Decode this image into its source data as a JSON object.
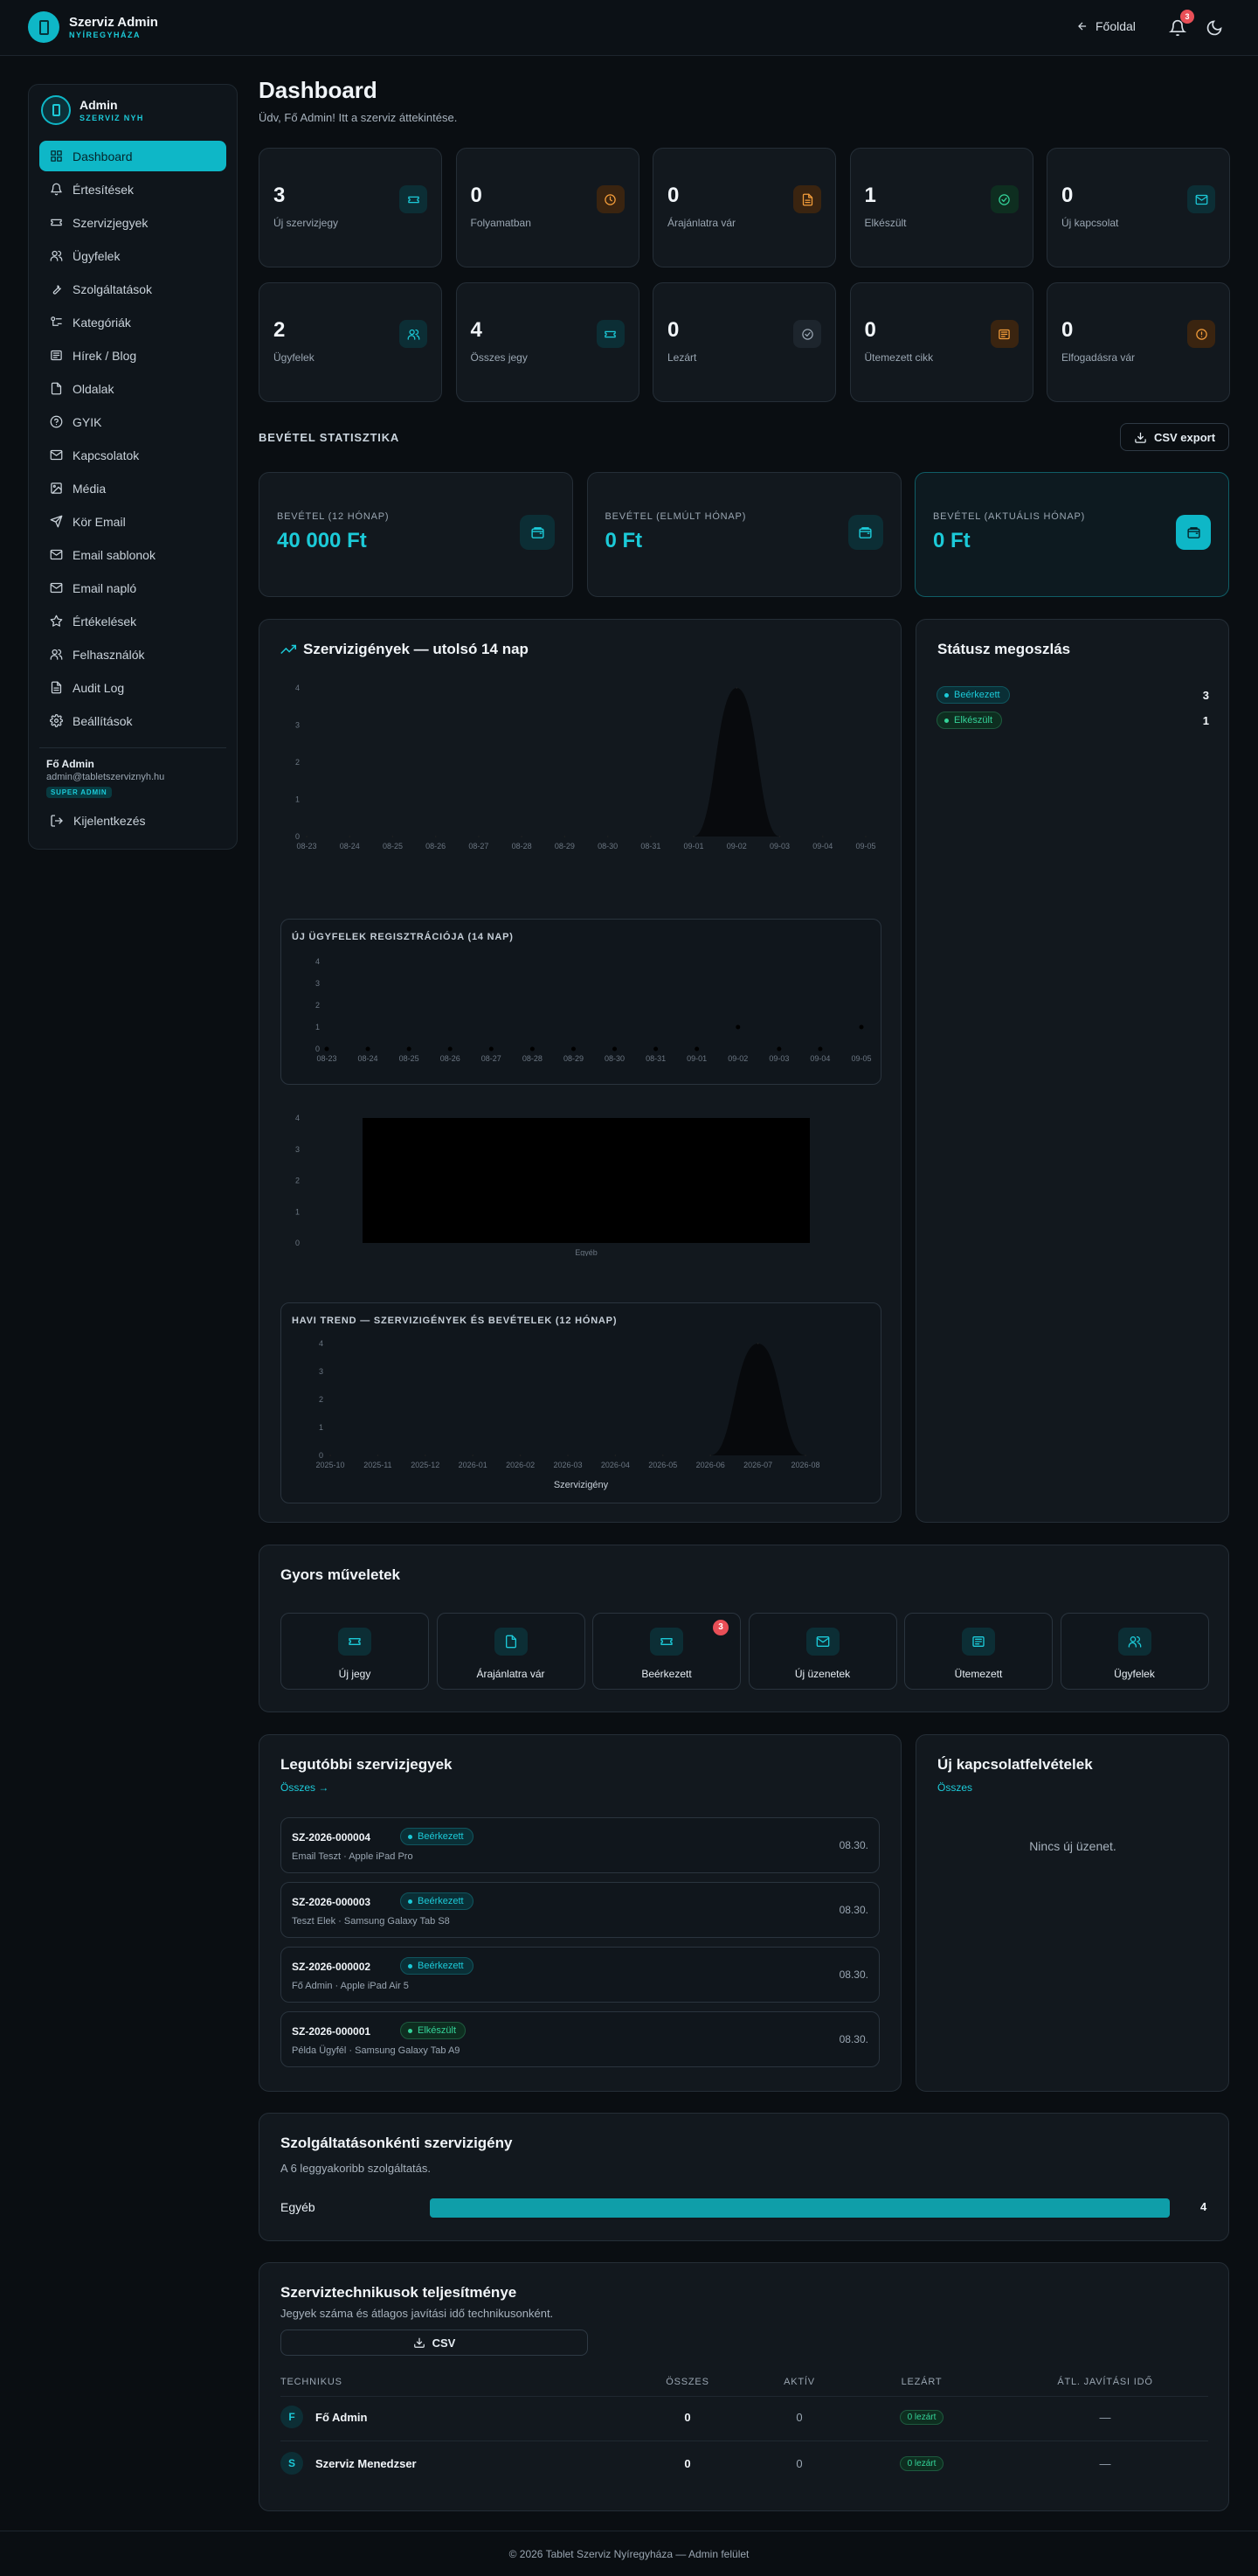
{
  "topbar": {
    "brand_title": "Szerviz Admin",
    "brand_sub": "NYÍREGYHÁZA",
    "back_label": "Főoldal",
    "notif_count": "3"
  },
  "sidebar": {
    "title": "Admin",
    "subtitle": "SZERVIZ NYH",
    "items": [
      {
        "label": "Dashboard",
        "icon": "dashboard-icon"
      },
      {
        "label": "Értesítések",
        "icon": "bell-icon"
      },
      {
        "label": "Szervizjegyek",
        "icon": "ticket-icon"
      },
      {
        "label": "Ügyfelek",
        "icon": "users-icon"
      },
      {
        "label": "Szolgáltatások",
        "icon": "wrench-icon"
      },
      {
        "label": "Kategóriák",
        "icon": "category-icon"
      },
      {
        "label": "Hírek / Blog",
        "icon": "newspaper-icon"
      },
      {
        "label": "Oldalak",
        "icon": "page-icon"
      },
      {
        "label": "GYIK",
        "icon": "help-icon"
      },
      {
        "label": "Kapcsolatok",
        "icon": "mail-icon"
      },
      {
        "label": "Média",
        "icon": "image-icon"
      },
      {
        "label": "Kör Email",
        "icon": "send-icon"
      },
      {
        "label": "Email sablonok",
        "icon": "mail-template-icon"
      },
      {
        "label": "Email napló",
        "icon": "mail-log-icon"
      },
      {
        "label": "Értékelések",
        "icon": "star-icon"
      },
      {
        "label": "Felhasználók",
        "icon": "users-icon"
      },
      {
        "label": "Audit Log",
        "icon": "file-icon"
      },
      {
        "label": "Beállítások",
        "icon": "gear-icon"
      }
    ],
    "user_name": "Fő Admin",
    "user_email": "admin@tabletszerviznyh.hu",
    "user_role": "SUPER ADMIN",
    "logout_label": "Kijelentkezés"
  },
  "page": {
    "title": "Dashboard",
    "subtitle": "Üdv, Fő Admin! Itt a szerviz áttekintése."
  },
  "stats": [
    {
      "value": "3",
      "label": "Új szervizjegy"
    },
    {
      "value": "0",
      "label": "Folyamatban"
    },
    {
      "value": "0",
      "label": "Árajánlatra vár"
    },
    {
      "value": "1",
      "label": "Elkészült"
    },
    {
      "value": "0",
      "label": "Új kapcsolat"
    },
    {
      "value": "2",
      "label": "Ügyfelek"
    },
    {
      "value": "4",
      "label": "Összes jegy"
    },
    {
      "value": "0",
      "label": "Lezárt"
    },
    {
      "value": "0",
      "label": "Ütemezett cikk"
    },
    {
      "value": "0",
      "label": "Elfogadásra vár"
    }
  ],
  "revenue": {
    "section_title": "BEVÉTEL STATISZTIKA",
    "csv_label": "CSV export",
    "cards": [
      {
        "label": "BEVÉTEL (12 HÓNAP)",
        "value": "40 000 Ft"
      },
      {
        "label": "BEVÉTEL (ELMÚLT HÓNAP)",
        "value": "0 Ft"
      },
      {
        "label": "BEVÉTEL (AKTUÁLIS HÓNAP)",
        "value": "0 Ft"
      }
    ]
  },
  "tickets_chart": {
    "title": "Szervizigények — utolsó 14 nap"
  },
  "customers_chart": {
    "title": "ÚJ ÜGYFELEK REGISZTRÁCIÓJA (14 NAP)"
  },
  "monthly_chart": {
    "title": "HAVI TREND — SZERVIZIGÉNYEK ÉS BEVÉTELEK (12 HÓNAP)",
    "legend": "Szervizigény"
  },
  "chart_data": [
    {
      "type": "area",
      "title": "Szervizigények — utolsó 14 nap",
      "x": [
        "08-23",
        "08-24",
        "08-25",
        "08-26",
        "08-27",
        "08-28",
        "08-29",
        "08-30",
        "08-31",
        "09-01",
        "09-02",
        "09-03",
        "09-04",
        "09-05"
      ],
      "values": [
        0,
        0,
        0,
        0,
        0,
        0,
        0,
        0,
        0,
        0,
        4,
        0,
        0,
        0
      ],
      "ylim": [
        0,
        4
      ],
      "yticks": [
        0,
        1,
        2,
        3,
        4
      ]
    },
    {
      "type": "line",
      "title": "ÚJ ÜGYFELEK REGISZTRÁCIÓJA (14 NAP)",
      "x": [
        "08-23",
        "08-24",
        "08-25",
        "08-26",
        "08-27",
        "08-28",
        "08-29",
        "08-30",
        "08-31",
        "09-01",
        "09-02",
        "09-03",
        "09-04",
        "09-05"
      ],
      "values": [
        0,
        0,
        0,
        0,
        0,
        0,
        0,
        0,
        0,
        0,
        1,
        0,
        0,
        1
      ],
      "ylim": [
        0,
        4
      ],
      "yticks": [
        0,
        1,
        2,
        3,
        4
      ]
    },
    {
      "type": "bar",
      "title": "",
      "categories": [
        "Egyéb"
      ],
      "values": [
        4
      ],
      "ylim": [
        0,
        4
      ],
      "yticks": [
        0,
        1,
        2,
        3,
        4
      ]
    },
    {
      "type": "area",
      "title": "HAVI TREND — SZERVIZIGÉNYEK ÉS BEVÉTELEK (12 HÓNAP)",
      "x": [
        "2025-10",
        "2025-11",
        "2025-12",
        "2026-01",
        "2026-02",
        "2026-03",
        "2026-04",
        "2026-05",
        "2026-06",
        "2026-07",
        "2026-08"
      ],
      "series": [
        {
          "name": "Szervizigény",
          "values": [
            0,
            0,
            0,
            0,
            0,
            0,
            0,
            0,
            0,
            4,
            0
          ]
        }
      ],
      "ylim": [
        0,
        4
      ],
      "yticks": [
        0,
        1,
        2,
        3,
        4
      ]
    }
  ],
  "status_split": {
    "title": "Státusz megoszlás",
    "rows": [
      {
        "label": "Beérkezett",
        "count": "3"
      },
      {
        "label": "Elkészült",
        "count": "1"
      }
    ]
  },
  "quick": {
    "title": "Gyors műveletek",
    "items": [
      {
        "label": "Új jegy"
      },
      {
        "label": "Árajánlatra vár"
      },
      {
        "label": "Beérkezett",
        "badge": "3"
      },
      {
        "label": "Új üzenetek"
      },
      {
        "label": "Ütemezett"
      },
      {
        "label": "Ügyfelek"
      }
    ]
  },
  "recent": {
    "title": "Legutóbbi szervizjegyek",
    "all_label": "Összes →",
    "tickets": [
      {
        "id": "SZ-2026-000004",
        "status": "Beérkezett",
        "sub": "Email Teszt · Apple iPad Pro",
        "date": "08.30."
      },
      {
        "id": "SZ-2026-000003",
        "status": "Beérkezett",
        "sub": "Teszt Elek · Samsung Galaxy Tab S8",
        "date": "08.30."
      },
      {
        "id": "SZ-2026-000002",
        "status": "Beérkezett",
        "sub": "Fő Admin · Apple iPad Air 5",
        "date": "08.30."
      },
      {
        "id": "SZ-2026-000001",
        "status": "Elkészült",
        "sub": "Példa Ügyfél · Samsung Galaxy Tab A9",
        "date": "08.30."
      }
    ]
  },
  "contacts": {
    "title": "Új kapcsolatfelvételek",
    "all_label": "Összes",
    "empty": "Nincs új üzenet."
  },
  "services": {
    "title": "Szolgáltatásonkénti szervizigény",
    "subtitle": "A 6 leggyakoribb szolgáltatás.",
    "rows": [
      {
        "name": "Egyéb",
        "value": "4",
        "fraction": 1
      }
    ]
  },
  "techs": {
    "title": "Szerviztechnikusok teljesítménye",
    "subtitle": "Jegyek száma és átlagos javítási idő technikusonként.",
    "csv_label": "CSV",
    "headers": [
      "TECHNIKUS",
      "ÖSSZES",
      "AKTÍV",
      "LEZÁRT",
      "ÁTL. JAVÍTÁSI IDŐ"
    ],
    "rows": [
      {
        "initial": "F",
        "name": "Fő Admin",
        "total": "0",
        "active": "0",
        "closed": "0 lezárt",
        "avg": "—"
      },
      {
        "initial": "S",
        "name": "Szerviz Menedzser",
        "total": "0",
        "active": "0",
        "closed": "0 lezárt",
        "avg": "—"
      }
    ]
  },
  "footer": "© 2026 Tablet Szerviz Nyíregyháza — Admin felület"
}
